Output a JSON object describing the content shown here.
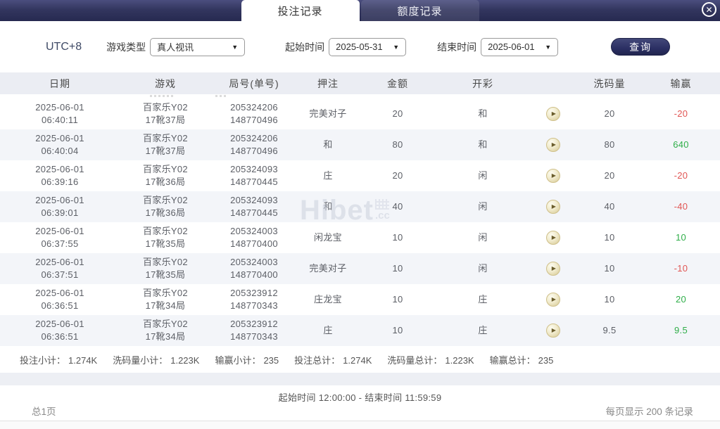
{
  "tabs": [
    {
      "label": "投注记录",
      "active": true
    },
    {
      "label": "额度记录",
      "active": false
    }
  ],
  "icons": {
    "close": "✕",
    "caret": "▼",
    "play": "▶"
  },
  "filters": {
    "timezone": "UTC+8",
    "game_type_label": "游戏类型",
    "game_type_value": "真人视讯",
    "start_label": "起始时间",
    "start_value": "2025-05-31",
    "end_label": "结束时间",
    "end_value": "2025-06-01",
    "query_label": "查询"
  },
  "table": {
    "headers": [
      "日期",
      "游戏",
      "局号(单号)",
      "押注",
      "金额",
      "开彩",
      "",
      "洗码量",
      "输赢"
    ],
    "rows": [
      {
        "date": "2025-06-01",
        "time": "06:40:11",
        "game": "百家乐Y02",
        "round": "17靴37局",
        "no1": "205324206",
        "no2": "148770496",
        "bet": "完美对子",
        "amount": "20",
        "result": "和",
        "wash": "20",
        "winloss": "-20",
        "sign": "neg"
      },
      {
        "date": "2025-06-01",
        "time": "06:40:04",
        "game": "百家乐Y02",
        "round": "17靴37局",
        "no1": "205324206",
        "no2": "148770496",
        "bet": "和",
        "amount": "80",
        "result": "和",
        "wash": "80",
        "winloss": "640",
        "sign": "pos"
      },
      {
        "date": "2025-06-01",
        "time": "06:39:16",
        "game": "百家乐Y02",
        "round": "17靴36局",
        "no1": "205324093",
        "no2": "148770445",
        "bet": "庄",
        "amount": "20",
        "result": "闲",
        "wash": "20",
        "winloss": "-20",
        "sign": "neg"
      },
      {
        "date": "2025-06-01",
        "time": "06:39:01",
        "game": "百家乐Y02",
        "round": "17靴36局",
        "no1": "205324093",
        "no2": "148770445",
        "bet": "和",
        "amount": "40",
        "result": "闲",
        "wash": "40",
        "winloss": "-40",
        "sign": "neg"
      },
      {
        "date": "2025-06-01",
        "time": "06:37:55",
        "game": "百家乐Y02",
        "round": "17靴35局",
        "no1": "205324003",
        "no2": "148770400",
        "bet": "闲龙宝",
        "amount": "10",
        "result": "闲",
        "wash": "10",
        "winloss": "10",
        "sign": "pos"
      },
      {
        "date": "2025-06-01",
        "time": "06:37:51",
        "game": "百家乐Y02",
        "round": "17靴35局",
        "no1": "205324003",
        "no2": "148770400",
        "bet": "完美对子",
        "amount": "10",
        "result": "闲",
        "wash": "10",
        "winloss": "-10",
        "sign": "neg"
      },
      {
        "date": "2025-06-01",
        "time": "06:36:51",
        "game": "百家乐Y02",
        "round": "17靴34局",
        "no1": "205323912",
        "no2": "148770343",
        "bet": "庄龙宝",
        "amount": "10",
        "result": "庄",
        "wash": "10",
        "winloss": "20",
        "sign": "pos"
      },
      {
        "date": "2025-06-01",
        "time": "06:36:51",
        "game": "百家乐Y02",
        "round": "17靴34局",
        "no1": "205323912",
        "no2": "148770343",
        "bet": "庄",
        "amount": "10",
        "result": "庄",
        "wash": "9.5",
        "winloss": "9.5",
        "sign": "pos"
      }
    ]
  },
  "summary": {
    "items": [
      {
        "label": "投注小计：",
        "value": "1.274K"
      },
      {
        "label": "洗码量小计：",
        "value": "1.223K"
      },
      {
        "label": "输赢小计：",
        "value": "235"
      },
      {
        "label": "投注总计：",
        "value": "1.274K"
      },
      {
        "label": "洗码量总计：",
        "value": "1.223K"
      },
      {
        "label": "输赢总计：",
        "value": "235"
      }
    ]
  },
  "watermark": {
    "text": "Hibet",
    "suffix": ".cc"
  },
  "footer": {
    "time_range": "起始时间 12:00:00 - 结束时间 11:59:59",
    "pages": "总1页",
    "per_page": "每页显示 200 条记录"
  },
  "colors": {
    "topbar": "#33365f",
    "accent": "#2b2f63",
    "win": "#2fae49",
    "loss": "#e15654",
    "header_bg": "#ebedf3",
    "row_alt": "#f3f5f9"
  }
}
